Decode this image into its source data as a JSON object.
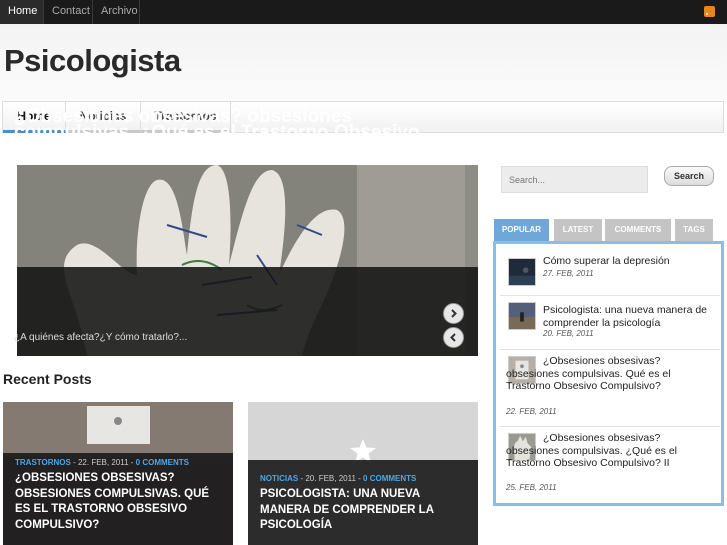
{
  "topnav": {
    "items": [
      "Home",
      "Contact",
      "Archivo"
    ]
  },
  "site": {
    "title": "Psicologista"
  },
  "mainnav": {
    "tabs": [
      "Home",
      "Noticias",
      "Trastornos"
    ]
  },
  "slider": {
    "title": "¿Obsesiones obsesivas? obsesiones compulsivas. ¿Qué es el Trastorno Obsesivo Compulsivo? II",
    "excerpt": "¿A quiénes afecta?¿Y cómo tratarlo?..."
  },
  "recent": {
    "heading": "Recent Posts",
    "posts": [
      {
        "category": "TRASTORNOS",
        "date": " - 22. FEB, 2011 - ",
        "comments": "0 COMMENTS",
        "title": "¿OBSESIONES OBSESIVAS? OBSESIONES COMPULSIVAS. QUÉ ES EL TRASTORNO OBSESIVO COMPULSIVO?"
      },
      {
        "category": "NOTICIAS",
        "date": " - 20. FEB, 2011 - ",
        "comments": "0 COMMENTS",
        "title": "PSICOLOGISTA: UNA NUEVA MANERA DE COMPRENDER LA PSICOLOGÍA"
      }
    ]
  },
  "search": {
    "placeholder": "Search...",
    "button": "Search"
  },
  "widget": {
    "tabs": [
      "POPULAR",
      "LATEST",
      "COMMENTS",
      "TAGS"
    ],
    "items": [
      {
        "title": "Cómo superar la depresión",
        "date": "27. FEB, 2011"
      },
      {
        "title": "Psicologista: una nueva manera de comprender la psicología",
        "date": "20. FEB, 2011"
      },
      {
        "title": "¿Obsesiones obsesivas? obsesiones compulsivas. Qué es el Trastorno Obsesivo Compulsivo?",
        "date": "22. FEB, 2011"
      },
      {
        "title": "¿Obsesiones obsesivas? obsesiones compulsivas. ¿Qué es el Trastorno Obsesivo Compulsivo? II",
        "date": "25. FEB, 2011"
      }
    ]
  },
  "icons": {
    "rss": "rss-icon",
    "next": "chevron-right-icon",
    "prev": "chevron-left-icon",
    "placeholder": "star-icon"
  },
  "colors": {
    "accent": "#4a8fc7",
    "widget_border": "#8ebde3",
    "link_blue": "#4da6e8"
  }
}
